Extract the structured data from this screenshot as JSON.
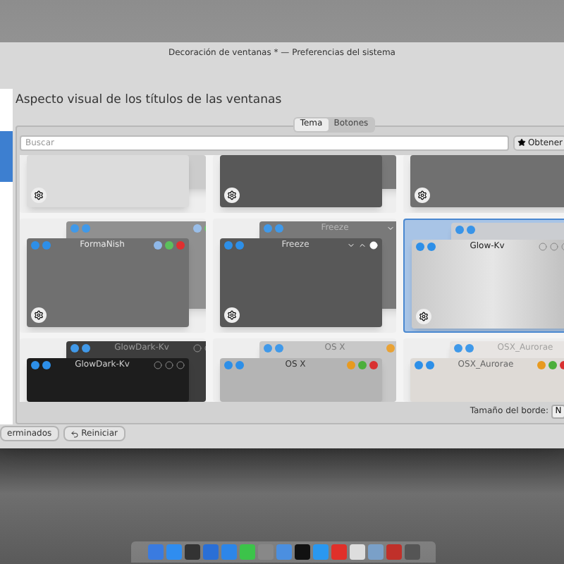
{
  "window": {
    "title": "Decoración de ventanas * — Preferencias del sistema"
  },
  "heading": "Aspecto visual de los títulos de las ventanas",
  "tabs": [
    {
      "label": "Tema",
      "selected": true
    },
    {
      "label": "Botones",
      "selected": false
    }
  ],
  "search": {
    "placeholder": "Buscar"
  },
  "get_button": "Obtener",
  "previews": [
    [
      {
        "kind": "light",
        "selected": false
      },
      {
        "kind": "darkgray",
        "selected": false
      },
      {
        "kind": "gray",
        "selected": false
      }
    ],
    [
      {
        "kind": "gray",
        "title": "FormaNish",
        "selected": false
      },
      {
        "kind": "darkgray",
        "title": "Freeze",
        "back_title": "Freeze",
        "selected": false
      },
      {
        "kind": "silver",
        "title": "Glow-Kv",
        "selected": true
      }
    ],
    [
      {
        "kind": "black",
        "title": "GlowDark-Kv",
        "back_title": "GlowDark-Kv",
        "selected": false
      },
      {
        "kind": "osx",
        "title": "OS X",
        "back_title": "OS X",
        "selected": false
      },
      {
        "kind": "aurorae",
        "title": "OSX_Aurorae",
        "back_title": "OSX_Aurorae",
        "selected": false
      }
    ]
  ],
  "border_size": {
    "label": "Tamaño del borde:",
    "value": "N"
  },
  "buttons": [
    {
      "label": "erminados",
      "kind": "plain"
    },
    {
      "label": "Reiniciar",
      "kind": "reset"
    }
  ]
}
